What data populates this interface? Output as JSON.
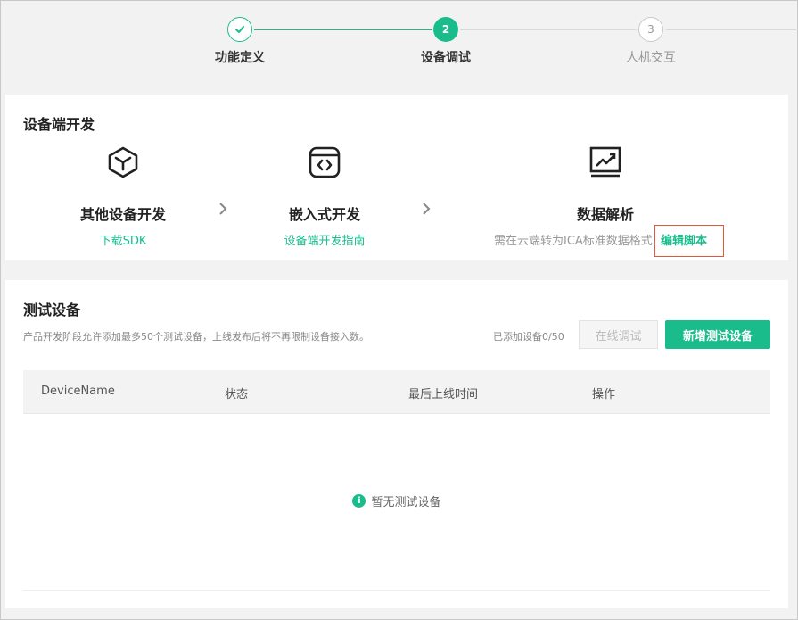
{
  "stepper": {
    "steps": [
      {
        "number": "1",
        "label": "功能定义",
        "status": "done"
      },
      {
        "number": "2",
        "label": "设备调试",
        "status": "active"
      },
      {
        "number": "3",
        "label": "人机交互",
        "status": "pending"
      }
    ],
    "accent": "#1abc8c"
  },
  "device_dev": {
    "title": "设备端开发",
    "options": [
      {
        "icon": "cube-icon",
        "title": "其他设备开发",
        "link": "下载SDK"
      },
      {
        "icon": "embedded-code-icon",
        "title": "嵌入式开发",
        "link": "设备端开发指南"
      },
      {
        "icon": "chart-analysis-icon",
        "title": "数据解析",
        "desc": "需在云端转为ICA标准数据格式",
        "link": "编辑脚本"
      }
    ]
  },
  "test_devices": {
    "title": "测试设备",
    "description": "产品开发阶段允许添加最多50个测试设备，上线发布后将不再限制设备接入数。",
    "added_count": "已添加设备0/50",
    "online_debug_label": "在线调试",
    "add_device_label": "新增测试设备",
    "columns": [
      "DeviceName",
      "状态",
      "最后上线时间",
      "操作"
    ],
    "empty_text": "暂无测试设备",
    "empty_icon": "i"
  }
}
